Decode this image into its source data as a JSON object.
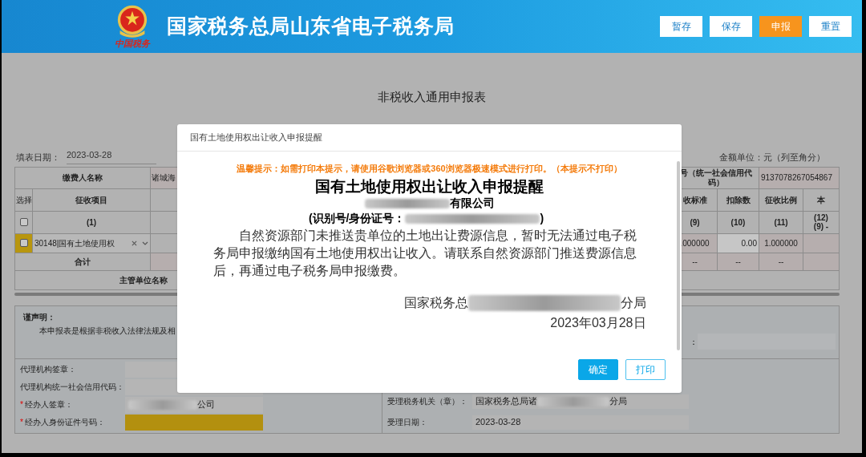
{
  "header": {
    "logo_caption": "中国税务",
    "title": "国家税务总局山东省电子税务局",
    "buttons": [
      {
        "label": "暂存",
        "kind": "default"
      },
      {
        "label": "保存",
        "kind": "default"
      },
      {
        "label": "申报",
        "kind": "primary"
      },
      {
        "label": "重置",
        "kind": "default"
      }
    ]
  },
  "form": {
    "title": "非税收入通用申报表",
    "fill_date_label": "填表日期：",
    "fill_date": "2023-03-28",
    "amount_unit": "金额单位：元（列至角分）"
  },
  "table_left": {
    "payer_label": "缴费人名称",
    "payer_value": "诸城海",
    "select_header": "选择",
    "item_header": "征收项目",
    "item_index": "(1)",
    "header_checked": false,
    "row_checked": false,
    "row_item": "30148|国有土地使用权",
    "total_label": "合计",
    "authority_label": "主管单位名称"
  },
  "table_right": {
    "credit_code_label": "号（统一社会信用代码）",
    "credit_code": "9137078267054867",
    "columns": [
      {
        "header": "收标准",
        "index": "(9)",
        "value": ".000000",
        "total": "--",
        "kind": "computed"
      },
      {
        "header": "扣除数",
        "index": "(10)",
        "value": "0.00",
        "total": "--",
        "kind": "input"
      },
      {
        "header": "征收比例",
        "index": "(11)",
        "value": "1.000000",
        "total": "--",
        "kind": "computed"
      },
      {
        "header": "本",
        "index": "(12)",
        "formula": "(9) -",
        "kind": "computed"
      }
    ]
  },
  "declaration": {
    "heading": "谨声明：",
    "text": "本申报表是根据非税收入法律法规及相"
  },
  "signatures": [
    {
      "label": "代理机构签章："
    },
    {
      "label": "代理机构统一社会信用代码："
    },
    {
      "mark": "*",
      "label": "经办人签章：",
      "redacted": true,
      "value": "公司"
    },
    {
      "mark": "*",
      "label": "经办人身份证件号码：",
      "highlighted": true
    }
  ],
  "right_top_label": "：",
  "acceptance": [
    {
      "label": "受理税务机关（章）：",
      "value": "国家税务总局诸",
      "redacted": true,
      "value_after": "分局"
    },
    {
      "label": "受理日期：",
      "value": "2023-03-28"
    }
  ],
  "modal": {
    "title": "国有土地使用权出让收入申报提醒",
    "notice": "温馨提示：如需打印本提示，请使用谷歌浏览器或360浏览器极速模式进行打印。（本提示不打印）",
    "heading": "国有土地使用权出让收入申报提醒",
    "company_suffix": "有限公司",
    "id_label": "(识别号/身份证号：",
    "id_close": ")",
    "body": "自然资源部门未推送贵单位的土地出让费源信息，暂时无法通过电子税务局申报缴纳国有土地使用权出让收入。请联系自然资源部门推送费源信息后，再通过电子税务局申报缴费。",
    "signer_prefix": "国家税务总",
    "signer_suffix": "分局",
    "date": "2023年03月28日",
    "buttons": [
      {
        "label": "确定",
        "kind": "primary"
      },
      {
        "label": "打印",
        "kind": "outline"
      }
    ]
  }
}
